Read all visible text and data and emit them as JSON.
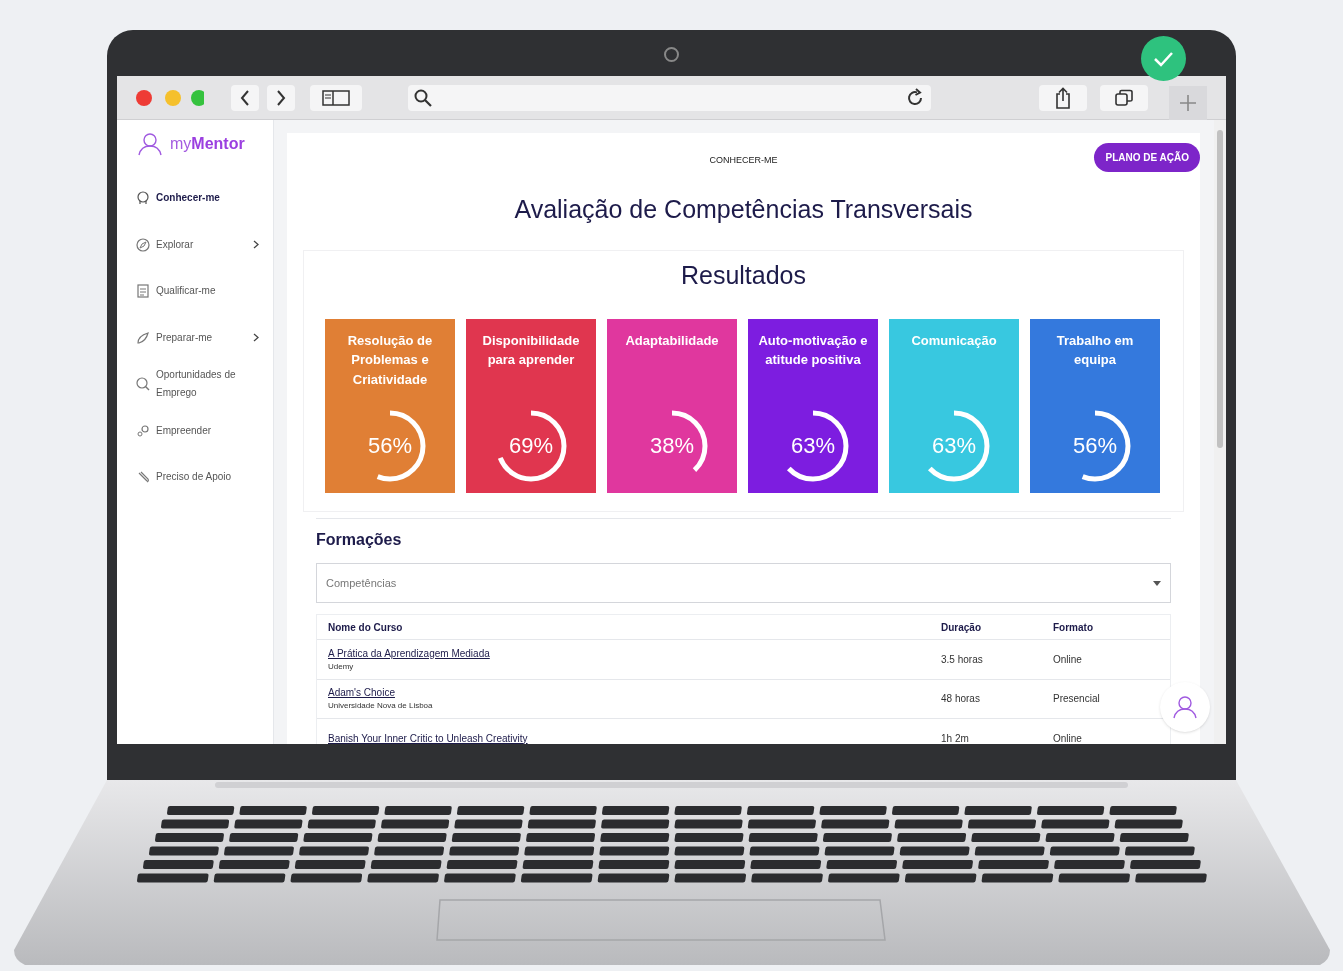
{
  "brand": "my**Mentor**",
  "sidebar": {
    "items": [
      {
        "label": "Conhecer-me",
        "selected": true,
        "expandable": false
      },
      {
        "label": "Explorar",
        "selected": false,
        "expandable": true
      },
      {
        "label": "Qualificar-me",
        "selected": false,
        "expandable": false
      },
      {
        "label": "Preparar-me",
        "selected": false,
        "expandable": true
      },
      {
        "label": "Oportunidades de Emprego",
        "selected": false,
        "expandable": false
      },
      {
        "label": "Empreender",
        "selected": false,
        "expandable": false
      },
      {
        "label": "Preciso de Apoio",
        "selected": false,
        "expandable": false
      }
    ]
  },
  "page": {
    "section": "CONHECER-ME",
    "action_button": "PLANO DE AÇÃO",
    "title": "Avaliação de Competências Transversais"
  },
  "results": {
    "title": "Resultados",
    "scores": [
      {
        "label": "Resolução de Problemas e Criatividade",
        "reading": "56%",
        "level": 0.56,
        "color": "#e07f35"
      },
      {
        "label": "Disponibilidade para aprender",
        "reading": "69%",
        "level": 0.69,
        "color": "#e0364f"
      },
      {
        "label": "Adaptabilidade",
        "reading": "38%",
        "level": 0.38,
        "color": "#e0379e"
      },
      {
        "label": "Auto-motivação e atitude positiva",
        "reading": "63%",
        "level": 0.63,
        "color": "#7d1de0"
      },
      {
        "label": "Comunicação",
        "reading": "63%",
        "level": 0.63,
        "color": "#38c8e0"
      },
      {
        "label": "Trabalho em equipa",
        "reading": "56%",
        "level": 0.56,
        "color": "#3479dd"
      }
    ]
  },
  "courses": {
    "title": "Formações",
    "filter": {
      "placeholder": "Competências"
    },
    "columns": [
      "Nome do Curso",
      "Duração",
      "Formato"
    ],
    "rows": [
      {
        "name": "A Prática da Aprendizagem Mediada",
        "provider": "Udemy",
        "duration": "3.5 horas",
        "format": "Online"
      },
      {
        "name": "Adam's Choice",
        "provider": "Universidade Nova de Lisboa",
        "duration": "48 horas",
        "format": "Presencial"
      },
      {
        "name": "Banish Your Inner Critic to Unleash Creativity",
        "duration": "1h 2m",
        "format": "Online"
      }
    ]
  }
}
